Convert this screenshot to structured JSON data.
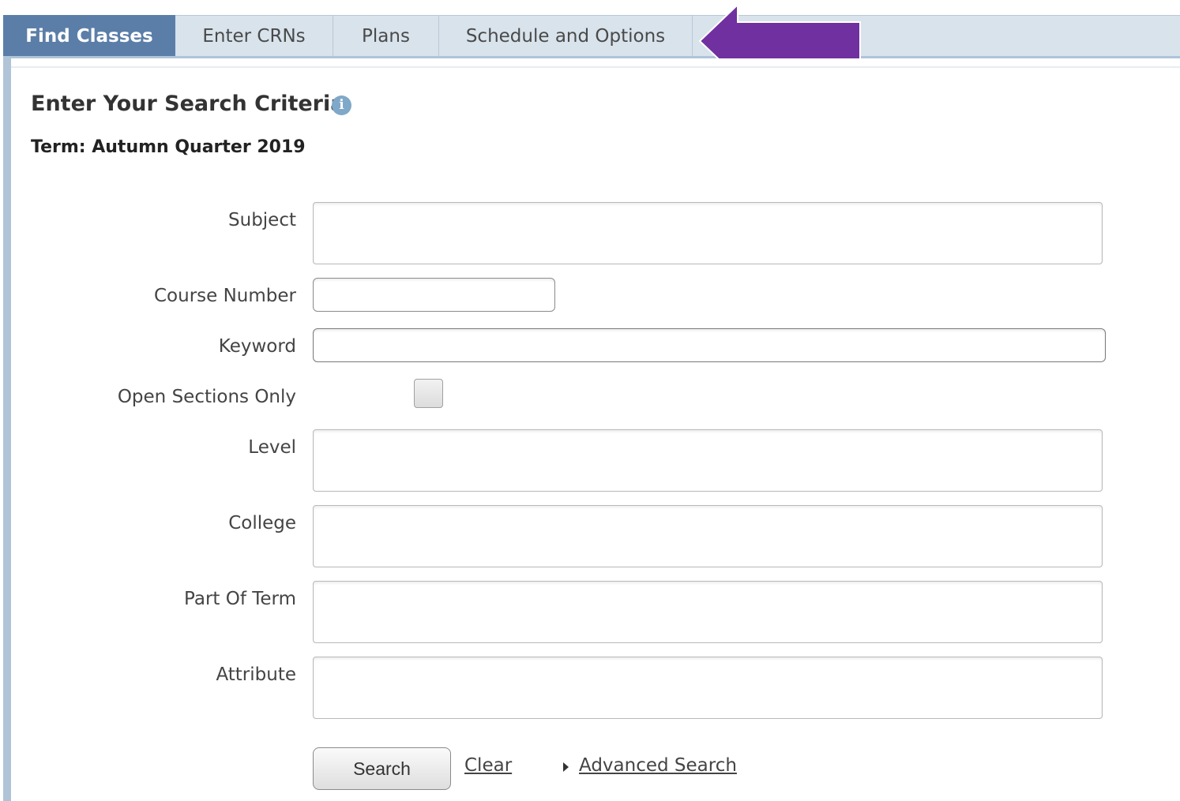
{
  "tabs": [
    {
      "label": "Find Classes",
      "active": true
    },
    {
      "label": "Enter CRNs",
      "active": false
    },
    {
      "label": "Plans",
      "active": false
    },
    {
      "label": "Schedule and Options",
      "active": false
    }
  ],
  "annotation": {
    "icon": "purple-arrow-left",
    "color": "#7030a0"
  },
  "search": {
    "heading": "Enter Your Search Criteria",
    "info_icon": "info-icon",
    "term": "Term: Autumn Quarter 2019",
    "fields": {
      "subject": {
        "label": "Subject",
        "value": ""
      },
      "course_number": {
        "label": "Course Number",
        "value": ""
      },
      "keyword": {
        "label": "Keyword",
        "value": ""
      },
      "open_sections": {
        "label": "Open Sections Only",
        "checked": false
      },
      "level": {
        "label": "Level",
        "value": ""
      },
      "college": {
        "label": "College",
        "value": ""
      },
      "part_of_term": {
        "label": "Part Of Term",
        "value": ""
      },
      "attribute": {
        "label": "Attribute",
        "value": ""
      }
    },
    "actions": {
      "search_label": "Search",
      "clear_label": "Clear",
      "advanced_label": "Advanced Search"
    }
  },
  "colors": {
    "active_tab": "#5b7ea8",
    "tabbar": "#d8e3ec",
    "panel_border": "#b0c4d8",
    "info_icon": "#7fa8c9"
  }
}
